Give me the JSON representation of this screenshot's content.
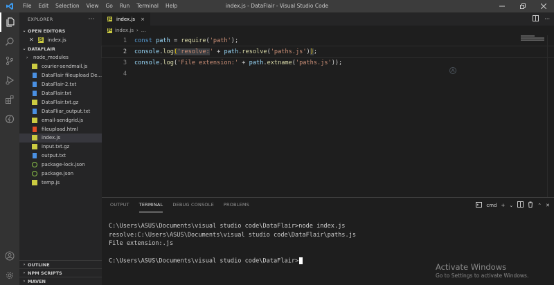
{
  "window": {
    "title": "index.js - DataFlair - Visual Studio Code",
    "menu": [
      "File",
      "Edit",
      "Selection",
      "View",
      "Go",
      "Run",
      "Terminal",
      "Help"
    ]
  },
  "sidebar": {
    "header": "EXPLORER",
    "open_editors_label": "OPEN EDITORS",
    "open_editors": [
      {
        "name": "index.js"
      }
    ],
    "folder_label": "DATAFLAIR",
    "files": [
      {
        "name": "node_modules",
        "type": "folder",
        "color": "#cccccc"
      },
      {
        "name": "courier-sendmail.js",
        "type": "js",
        "color": "#cbcb41"
      },
      {
        "name": "DataFlair fileupload De...",
        "type": "doc",
        "color": "#4a90e2"
      },
      {
        "name": "DataFlair-2.txt",
        "type": "doc",
        "color": "#4a90e2"
      },
      {
        "name": "DataFlair.txt",
        "type": "doc",
        "color": "#4a90e2"
      },
      {
        "name": "DataFlair.txt.gz",
        "type": "gz",
        "color": "#cbcb41"
      },
      {
        "name": "DataFliar_output.txt",
        "type": "doc",
        "color": "#4a90e2"
      },
      {
        "name": "email-sendgrid.js",
        "type": "js",
        "color": "#cbcb41"
      },
      {
        "name": "fileupload.html",
        "type": "html",
        "color": "#e44d26"
      },
      {
        "name": "index.js",
        "type": "js",
        "color": "#cbcb41",
        "selected": true
      },
      {
        "name": "input.txt.gz",
        "type": "gz",
        "color": "#cbcb41"
      },
      {
        "name": "output.txt",
        "type": "doc",
        "color": "#4a90e2"
      },
      {
        "name": "package-lock.json",
        "type": "json",
        "color": "#8bc34a"
      },
      {
        "name": "package.json",
        "type": "json",
        "color": "#8bc34a"
      },
      {
        "name": "temp.js",
        "type": "js",
        "color": "#cbcb41"
      }
    ],
    "bottom_sections": [
      "OUTLINE",
      "NPM SCRIPTS",
      "MAVEN"
    ]
  },
  "editor": {
    "tab_label": "index.js",
    "tab_close": "×",
    "breadcrumb_file": "index.js",
    "breadcrumb_sep": "›",
    "breadcrumb_more": "...",
    "lines": [
      {
        "num": "1"
      },
      {
        "num": "2"
      },
      {
        "num": "3"
      },
      {
        "num": "4"
      }
    ]
  },
  "panel": {
    "tabs": [
      "OUTPUT",
      "TERMINAL",
      "DEBUG CONSOLE",
      "PROBLEMS"
    ],
    "active_tab": "TERMINAL",
    "shell_label": "cmd",
    "terminal_lines": [
      "C:\\Users\\ASUS\\Documents\\visual studio code\\DataFlair>node index.js",
      "resolve:C:\\Users\\ASUS\\Documents\\visual studio code\\DataFlair\\paths.js",
      "File extension:.js",
      "",
      "C:\\Users\\ASUS\\Documents\\visual studio code\\DataFlair>"
    ]
  },
  "activation": {
    "title": "Activate Windows",
    "subtitle": "Go to Settings to activate Windows."
  }
}
